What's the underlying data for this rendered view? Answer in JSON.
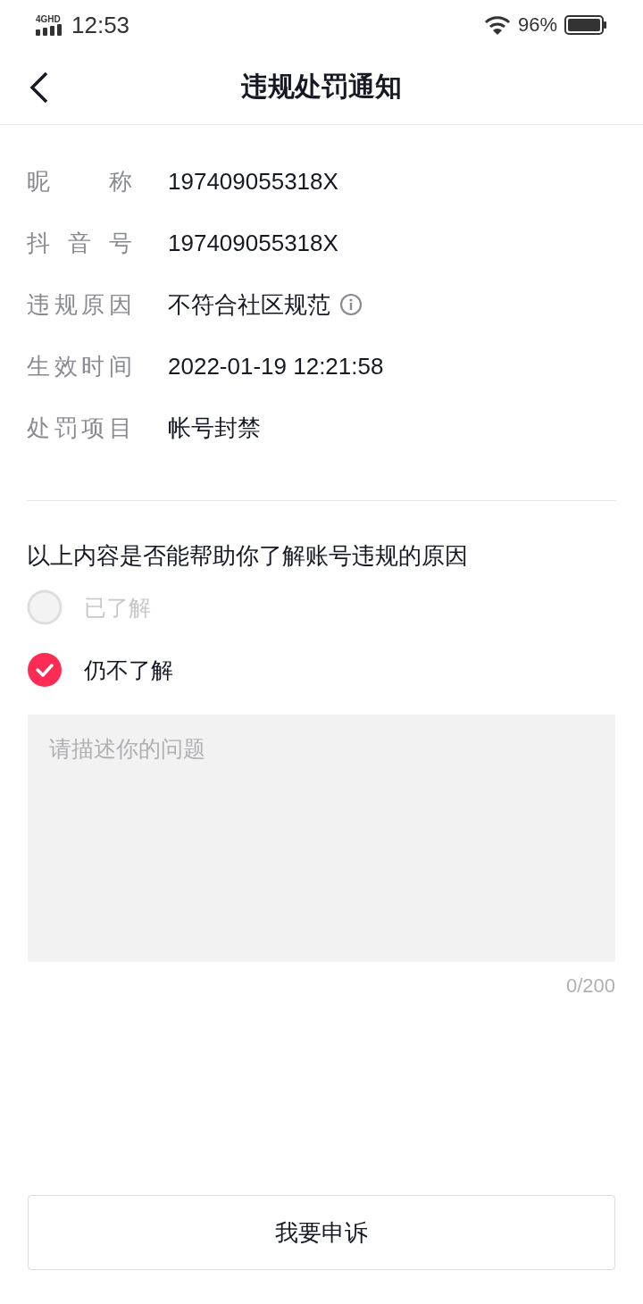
{
  "status_bar": {
    "network": "4GHD",
    "time": "12:53",
    "battery": "96%"
  },
  "header": {
    "title": "违规处罚通知"
  },
  "details": [
    {
      "label": "昵称",
      "value": "197409055318X"
    },
    {
      "label": "抖音号",
      "value": "197409055318X"
    },
    {
      "label": "违规原因",
      "value": "不符合社区规范",
      "kind": "info"
    },
    {
      "label": "生效时间",
      "value": "2022-01-19 12:21:58"
    },
    {
      "label": "处罚项目",
      "value": "帐号封禁"
    }
  ],
  "question": "以上内容是否能帮助你了解账号违规的原因",
  "options": [
    {
      "label": "已了解",
      "selected": false,
      "disabled": true
    },
    {
      "label": "仍不了解",
      "selected": true,
      "disabled": false
    }
  ],
  "description": {
    "placeholder": "请描述你的问题",
    "counter": "0/200"
  },
  "submit_button": "我要申诉"
}
